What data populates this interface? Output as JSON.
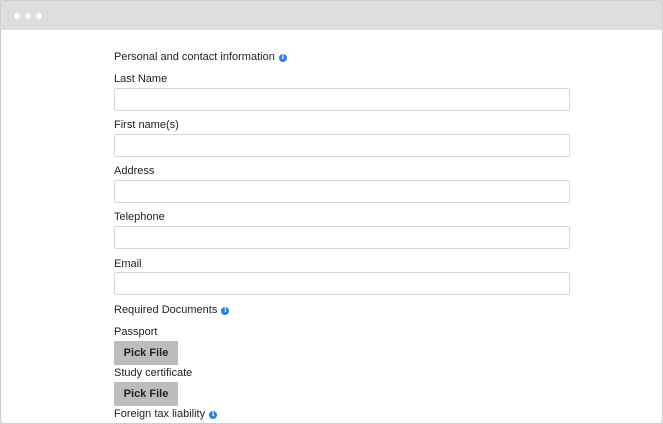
{
  "window": {
    "controls": [
      "dot",
      "dot",
      "dot"
    ]
  },
  "form": {
    "personal_section": {
      "title": "Personal and contact information",
      "icon": "info-icon"
    },
    "fields": [
      {
        "label": "Last Name",
        "value": "",
        "placeholder": ""
      },
      {
        "label": "First name(s)",
        "value": "",
        "placeholder": ""
      },
      {
        "label": "Address",
        "value": "",
        "placeholder": ""
      },
      {
        "label": "Telephone",
        "value": "",
        "placeholder": ""
      },
      {
        "label": "Email",
        "value": "",
        "placeholder": ""
      }
    ],
    "documents_section": {
      "title": "Required Documents",
      "icon": "info-icon"
    },
    "documents": [
      {
        "label": "Passport",
        "button_label": "Pick File"
      },
      {
        "label": "Study certificate",
        "button_label": "Pick File"
      }
    ],
    "tax_section": {
      "title": "Foreign tax liability",
      "icon": "info-icon"
    }
  },
  "colors": {
    "titlebar": "#dedede",
    "info_icon": "#2f7ee0",
    "button": "#bdbdbd",
    "field_border": "#d8d8d8"
  }
}
